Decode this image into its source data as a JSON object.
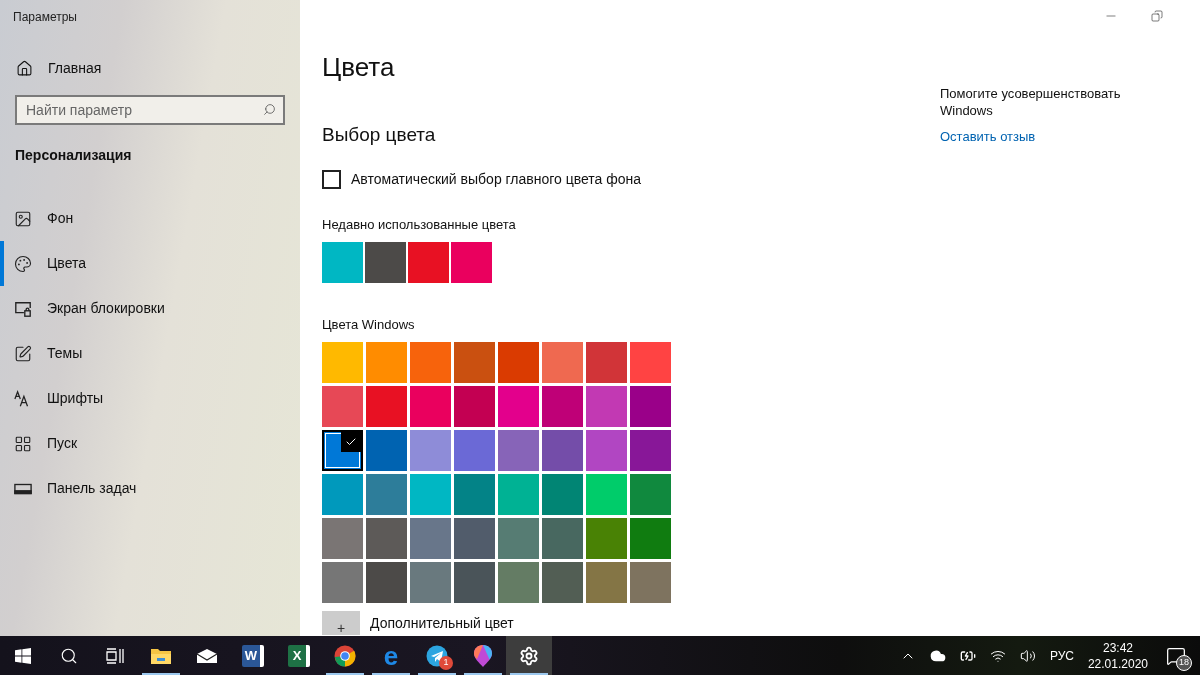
{
  "window": {
    "title": "Параметры",
    "controls": [
      {
        "kind": "minimize"
      },
      {
        "kind": "restore"
      }
    ]
  },
  "sidebar": {
    "home": "Главная",
    "search": {
      "placeholder": "Найти параметр"
    },
    "section": "Персонализация",
    "items": [
      {
        "label": "Фон",
        "kind": "background",
        "selected": false
      },
      {
        "label": "Цвета",
        "kind": "colors",
        "selected": true
      },
      {
        "label": "Экран блокировки",
        "kind": "lock",
        "selected": false
      },
      {
        "label": "Темы",
        "kind": "themes",
        "selected": false
      },
      {
        "label": "Шрифты",
        "kind": "fonts",
        "selected": false
      },
      {
        "label": "Пуск",
        "kind": "start",
        "selected": false
      },
      {
        "label": "Панель задач",
        "kind": "taskbar",
        "selected": false
      }
    ]
  },
  "page": {
    "title": "Цвета",
    "heading": "Выбор цвета",
    "auto_color": {
      "label": "Автоматический выбор главного цвета фона",
      "checked": false
    },
    "recent": {
      "label": "Недавно использованные цвета",
      "colors": [
        {
          "color": "#00b7c3"
        },
        {
          "color": "#4c4a48"
        },
        {
          "color": "#e81123"
        },
        {
          "color": "#ea005e"
        }
      ]
    },
    "windows_colors": {
      "label": "Цвета Windows",
      "swatches": [
        {
          "color": "#ffb900",
          "selected": false
        },
        {
          "color": "#ff8c00",
          "selected": false
        },
        {
          "color": "#f7630c",
          "selected": false
        },
        {
          "color": "#ca5010",
          "selected": false
        },
        {
          "color": "#da3b01",
          "selected": false
        },
        {
          "color": "#ef6950",
          "selected": false
        },
        {
          "color": "#d13438",
          "selected": false
        },
        {
          "color": "#ff4343",
          "selected": false
        },
        {
          "color": "#e74856",
          "selected": false
        },
        {
          "color": "#e81123",
          "selected": false
        },
        {
          "color": "#ea005e",
          "selected": false
        },
        {
          "color": "#c30052",
          "selected": false
        },
        {
          "color": "#e3008c",
          "selected": false
        },
        {
          "color": "#bf0077",
          "selected": false
        },
        {
          "color": "#c239b3",
          "selected": false
        },
        {
          "color": "#9a0089",
          "selected": false
        },
        {
          "color": "#0078d7",
          "selected": true
        },
        {
          "color": "#0063b1",
          "selected": false
        },
        {
          "color": "#8e8cd8",
          "selected": false
        },
        {
          "color": "#6b69d6",
          "selected": false
        },
        {
          "color": "#8764b8",
          "selected": false
        },
        {
          "color": "#744da9",
          "selected": false
        },
        {
          "color": "#b146c2",
          "selected": false
        },
        {
          "color": "#881798",
          "selected": false
        },
        {
          "color": "#0099bc",
          "selected": false
        },
        {
          "color": "#2d7d9a",
          "selected": false
        },
        {
          "color": "#00b7c3",
          "selected": false
        },
        {
          "color": "#038387",
          "selected": false
        },
        {
          "color": "#00b294",
          "selected": false
        },
        {
          "color": "#018574",
          "selected": false
        },
        {
          "color": "#00cc6a",
          "selected": false
        },
        {
          "color": "#10893e",
          "selected": false
        },
        {
          "color": "#7a7574",
          "selected": false
        },
        {
          "color": "#5d5a58",
          "selected": false
        },
        {
          "color": "#68768a",
          "selected": false
        },
        {
          "color": "#515c6b",
          "selected": false
        },
        {
          "color": "#567c73",
          "selected": false
        },
        {
          "color": "#486860",
          "selected": false
        },
        {
          "color": "#498205",
          "selected": false
        },
        {
          "color": "#107c10",
          "selected": false
        },
        {
          "color": "#767676",
          "selected": false
        },
        {
          "color": "#4c4a48",
          "selected": false
        },
        {
          "color": "#69797e",
          "selected": false
        },
        {
          "color": "#4a5459",
          "selected": false
        },
        {
          "color": "#647c64",
          "selected": false
        },
        {
          "color": "#525e54",
          "selected": false
        },
        {
          "color": "#847545",
          "selected": false
        },
        {
          "color": "#7e735f",
          "selected": false
        }
      ]
    },
    "custom_color": {
      "icon": "+",
      "label": "Дополнительный цвет"
    }
  },
  "help": {
    "text": "Помогите усовершенствовать Windows",
    "link": "Оставить отзыв"
  },
  "taskbar": {
    "apps": [
      {
        "kind": "start",
        "running": false,
        "selected": false
      },
      {
        "kind": "search",
        "running": false,
        "selected": false
      },
      {
        "kind": "taskview",
        "running": false,
        "selected": false
      },
      {
        "kind": "folder",
        "running": true,
        "selected": false
      },
      {
        "kind": "mail",
        "running": false,
        "selected": false
      },
      {
        "kind": "word",
        "letter": "W",
        "running": false,
        "selected": false
      },
      {
        "kind": "excel",
        "letter": "X",
        "running": false,
        "selected": false
      },
      {
        "kind": "chrome",
        "running": true,
        "selected": false
      },
      {
        "kind": "edge",
        "letter": "e",
        "running": true,
        "selected": false
      },
      {
        "kind": "telegram",
        "badge": "1",
        "running": true,
        "selected": false
      },
      {
        "kind": "paint",
        "running": true,
        "selected": false
      },
      {
        "kind": "settings",
        "running": true,
        "selected": true
      }
    ],
    "tray": {
      "language": "РУС",
      "time": "23:42",
      "date": "22.01.2020",
      "notifications": "18"
    }
  }
}
